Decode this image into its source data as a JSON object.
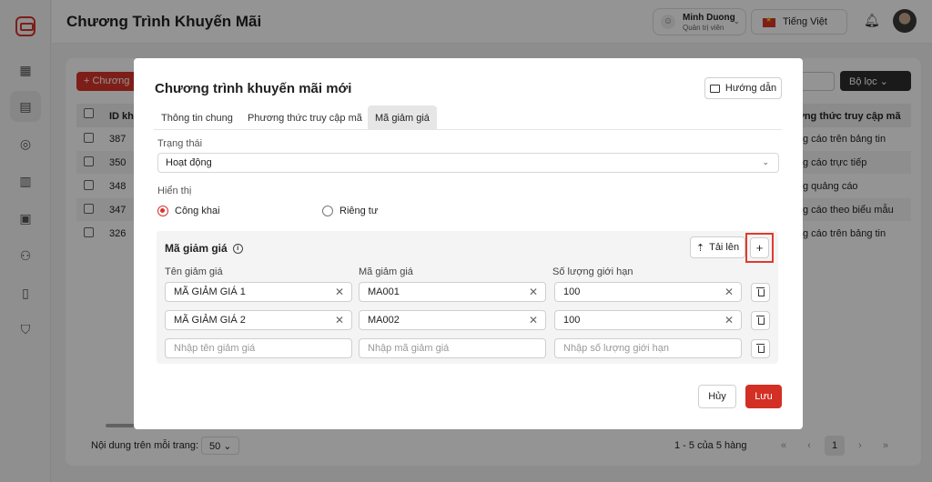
{
  "header": {
    "page_title": "Chương Trình Khuyến Mãi",
    "user_name": "Minh Duong",
    "user_role": "Quản trị viên",
    "language": "Tiếng Việt"
  },
  "background": {
    "add_button": "+ Chương",
    "filter_button": "Bộ lọc",
    "col_id": "ID khu",
    "col_method": "ơng thức truy cập mã",
    "rows": [
      {
        "id": "387",
        "method": "g cáo trên bảng tin"
      },
      {
        "id": "350",
        "method": "g cáo trực tiếp"
      },
      {
        "id": "348",
        "method": "g quảng cáo"
      },
      {
        "id": "347",
        "method": "g cáo theo biểu mẫu"
      },
      {
        "id": "326",
        "method": "g cáo trên bảng tin"
      }
    ],
    "per_page_label": "Nội dung trên mỗi trang:",
    "per_page_value": "50",
    "range_text": "1 - 5 của 5 hàng",
    "current_page": "1"
  },
  "modal": {
    "title": "Chương trình khuyến mãi mới",
    "guide_button": "Hướng dẫn",
    "tabs": [
      "Thông tin chung",
      "Phương thức truy cập mã",
      "Mã giảm giá"
    ],
    "status_label": "Trạng thái",
    "status_value": "Hoạt động",
    "visibility_label": "Hiển thị",
    "visibility_public": "Công khai",
    "visibility_private": "Riêng tư",
    "codes_title": "Mã giảm giá",
    "upload_button": "Tải lên",
    "add_button": "+",
    "columns": [
      "Tên giảm giá",
      "Mã giảm giá",
      "Số lượng giới hạn"
    ],
    "rows": [
      {
        "name": "MÃ GIẢM GIÁ 1",
        "code": "MA001",
        "limit": "100"
      },
      {
        "name": "MÃ GIẢM GIÁ 2",
        "code": "MA002",
        "limit": "100"
      }
    ],
    "placeholders": {
      "name": "Nhập tên giảm giá",
      "code": "Nhập mã giảm giá",
      "limit": "Nhập số lượng giới hạn"
    },
    "cancel_button": "Hủy",
    "save_button": "Lưu"
  },
  "colors": {
    "accent": "#d32f24",
    "highlight_outline": "#e03a2f"
  }
}
